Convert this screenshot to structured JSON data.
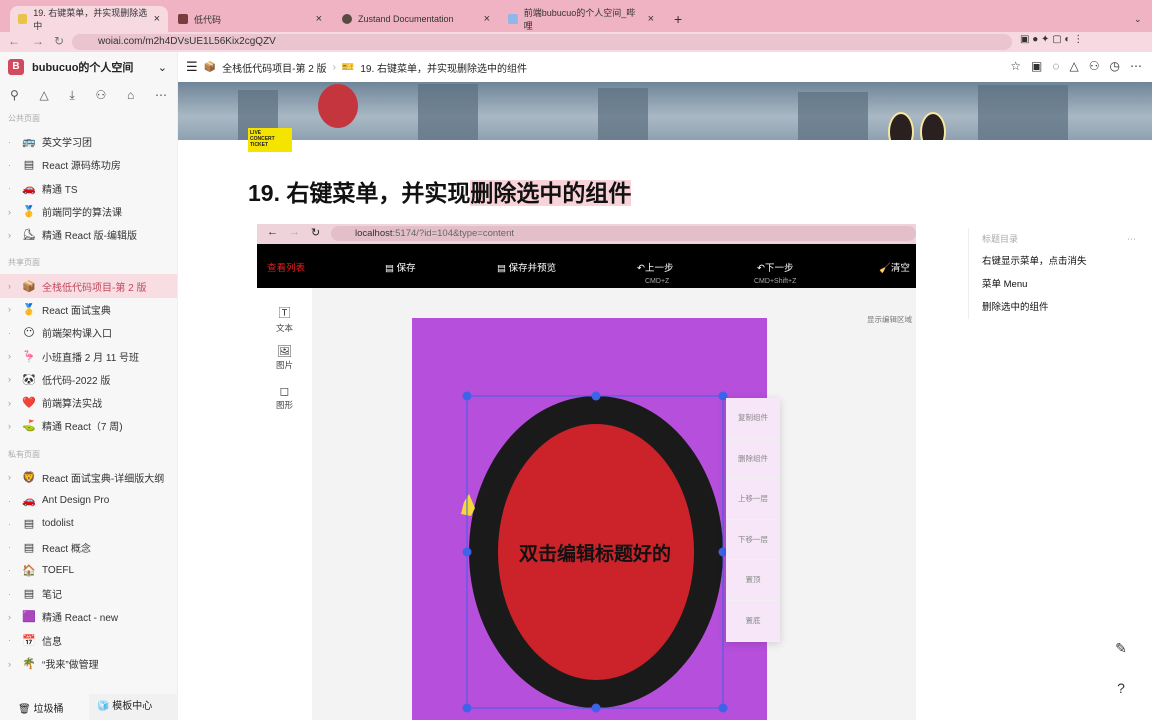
{
  "browser": {
    "tabs": [
      {
        "title": "19. 右键菜单，并实现删除选中",
        "active": true
      },
      {
        "title": "低代码"
      },
      {
        "title": "Zustand Documentation"
      },
      {
        "title": "前端bubucuo的个人空间_哔哩"
      }
    ],
    "url": "woiai.com/m2h4DVsUE1L56Kix2cgQZV"
  },
  "sidebar": {
    "workspace": "bubucuo的个人空间",
    "sections": [
      {
        "label": "公共页面",
        "items": [
          {
            "icon": "🚌",
            "label": "英文学习团"
          },
          {
            "icon": "▤",
            "label": "React 源码练功房"
          },
          {
            "icon": "🚗",
            "label": "精通 TS"
          },
          {
            "icon": "🥇",
            "label": "前端同学的算法课",
            "exp": true
          },
          {
            "icon": "⛸",
            "label": "精通 React 版-编辑版",
            "exp": true
          }
        ]
      },
      {
        "label": "共享页面",
        "items": [
          {
            "icon": "📦",
            "label": "全栈低代码项目-第 2 版",
            "exp": true,
            "selected": true
          },
          {
            "icon": "🥇",
            "label": "React 面试宝典",
            "exp": true
          },
          {
            "icon": "😶",
            "label": "前端架构课入口"
          },
          {
            "icon": "🦩",
            "label": "小班直播 2 月 11 号班",
            "exp": true
          },
          {
            "icon": "🐼",
            "label": "低代码-2022 版",
            "exp": true
          },
          {
            "icon": "❤️",
            "label": "前端算法实战",
            "exp": true
          },
          {
            "icon": "⛳",
            "label": "精通 React（7 周)",
            "exp": true
          }
        ]
      },
      {
        "label": "私有页面",
        "items": [
          {
            "icon": "🦁",
            "label": "React 面试宝典-详细版大纲",
            "exp": true
          },
          {
            "icon": "🚗",
            "label": "Ant Design Pro"
          },
          {
            "icon": "▤",
            "label": "todolist"
          },
          {
            "icon": "▤",
            "label": "React 概念"
          },
          {
            "icon": "🏠",
            "label": "TOEFL"
          },
          {
            "icon": "▤",
            "label": "笔记"
          },
          {
            "icon": "🟪",
            "label": "精通 React - new",
            "exp": true
          },
          {
            "icon": "📅",
            "label": "信息"
          },
          {
            "icon": "🌴",
            "label": "“我来”做管理",
            "exp": true
          }
        ]
      }
    ],
    "trash": "垃圾桶",
    "templates": "模板中心"
  },
  "header": {
    "crumb1": "全栈低代码项目-第 2 版",
    "crumb2": "19. 右键菜单，并实现删除选中的组件"
  },
  "page": {
    "title_a": "19. 右键菜单，并实现",
    "title_b": "删除选中的组件",
    "sticker": "LIVE CONCERT TICKET"
  },
  "embedded": {
    "url_host": "localhost",
    "url_rest": ":5174/?id=104&type=content",
    "toolbar": {
      "list": "查看列表",
      "save": "保存",
      "save_preview": "保存并预览",
      "undo": "上一步",
      "undo_key": "CMD+Z",
      "redo": "下一步",
      "redo_key": "CMD+Shift+Z",
      "clear": "清空"
    },
    "left": [
      {
        "icon": "🅃",
        "label": "文本"
      },
      {
        "icon": "🖼",
        "label": "图片"
      },
      {
        "icon": "◻",
        "label": "图形"
      }
    ],
    "show_edit": "显示编辑区域",
    "canvas_text": "双击编辑标题好的",
    "menu": [
      "复制组件",
      "删除组件",
      "上移一层",
      "下移一层",
      "置顶",
      "置底"
    ]
  },
  "toc": {
    "heading": "标题目录",
    "items": [
      "右键显示菜单，点击消失",
      "菜单 Menu",
      "删除选中的组件"
    ]
  },
  "colors": {
    "accent": "#c2475c",
    "canvas": "#b64fdc",
    "ellipse_outer": "#1a1a1a",
    "ellipse_inner": "#cc2229",
    "handle": "#3d63e8"
  }
}
